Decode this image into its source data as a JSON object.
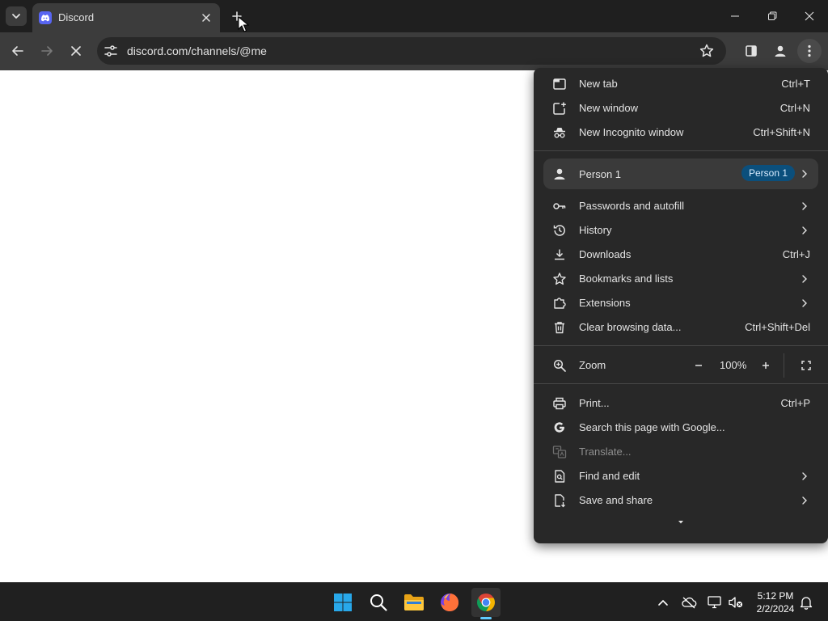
{
  "browser": {
    "tab": {
      "title": "Discord"
    },
    "address": {
      "url": "discord.com/channels/@me"
    }
  },
  "menu": {
    "new_tab": {
      "label": "New tab",
      "shortcut": "Ctrl+T"
    },
    "new_window": {
      "label": "New window",
      "shortcut": "Ctrl+N"
    },
    "new_incognito": {
      "label": "New Incognito window",
      "shortcut": "Ctrl+Shift+N"
    },
    "profile": {
      "label": "Person 1",
      "badge": "Person 1"
    },
    "passwords": {
      "label": "Passwords and autofill"
    },
    "history": {
      "label": "History"
    },
    "downloads": {
      "label": "Downloads",
      "shortcut": "Ctrl+J"
    },
    "bookmarks": {
      "label": "Bookmarks and lists"
    },
    "extensions": {
      "label": "Extensions"
    },
    "clear_data": {
      "label": "Clear browsing data...",
      "shortcut": "Ctrl+Shift+Del"
    },
    "zoom": {
      "label": "Zoom",
      "value": "100%"
    },
    "print": {
      "label": "Print...",
      "shortcut": "Ctrl+P"
    },
    "search_page": {
      "label": "Search this page with Google..."
    },
    "translate": {
      "label": "Translate..."
    },
    "find_edit": {
      "label": "Find and edit"
    },
    "save_share": {
      "label": "Save and share"
    }
  },
  "taskbar": {
    "clock": {
      "time": "5:12 PM",
      "date": "2/2/2024"
    }
  },
  "colors": {
    "tab_strip": "#1f1f1f",
    "toolbar": "#3c3c3c",
    "menu_bg": "#282828",
    "profile_badge": "#0b4f7c",
    "taskbar": "#202020",
    "accent": "#60cdff"
  }
}
